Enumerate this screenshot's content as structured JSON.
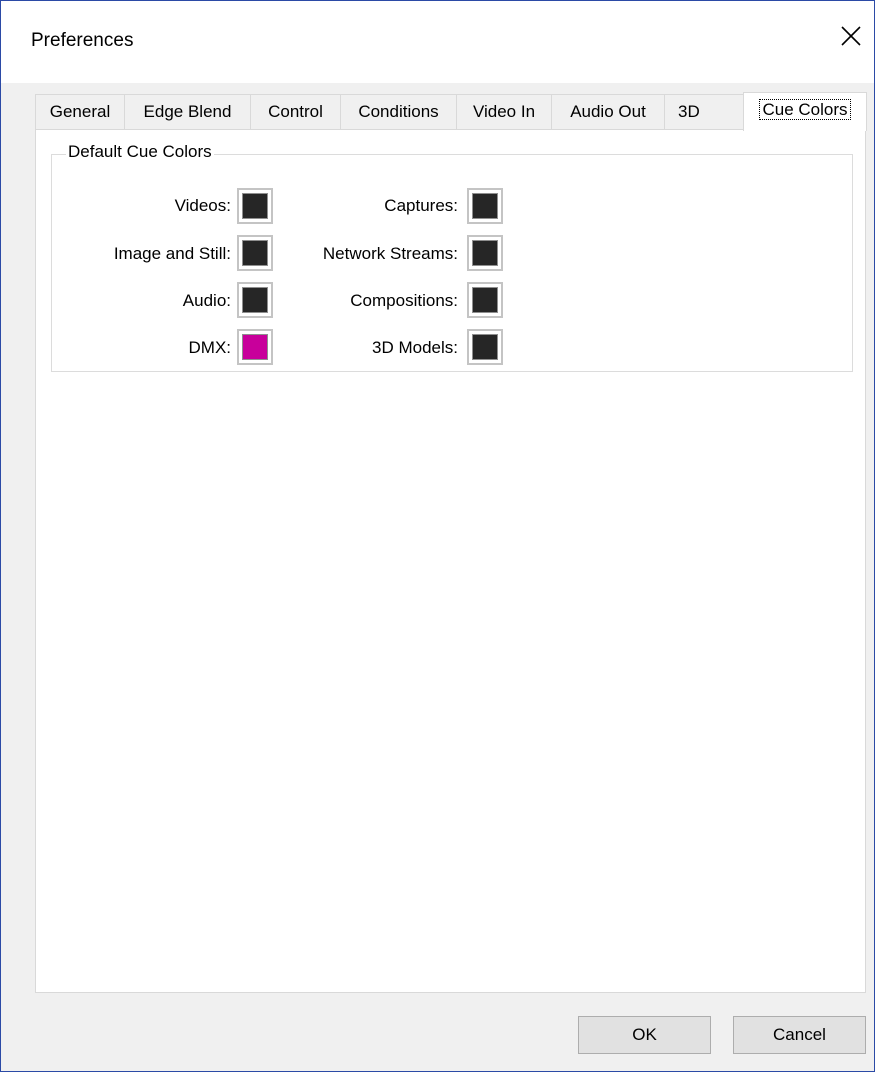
{
  "window": {
    "title": "Preferences"
  },
  "tabs": [
    {
      "label": "General"
    },
    {
      "label": "Edge Blend"
    },
    {
      "label": "Control"
    },
    {
      "label": "Conditions"
    },
    {
      "label": "Video In"
    },
    {
      "label": "Audio Out"
    },
    {
      "label": "3D"
    },
    {
      "label": "Cue Colors",
      "active": true
    }
  ],
  "cue_colors": {
    "group_title": "Default Cue Colors",
    "left": [
      {
        "label": "Videos:",
        "color": "#262626"
      },
      {
        "label": "Image and Still:",
        "color": "#262626"
      },
      {
        "label": "Audio:",
        "color": "#262626"
      },
      {
        "label": "DMX:",
        "color": "#c8009b"
      }
    ],
    "right": [
      {
        "label": "Captures:",
        "color": "#262626"
      },
      {
        "label": "Network Streams:",
        "color": "#262626"
      },
      {
        "label": "Compositions:",
        "color": "#262626"
      },
      {
        "label": "3D Models:",
        "color": "#262626"
      }
    ]
  },
  "buttons": {
    "ok": "OK",
    "cancel": "Cancel"
  }
}
